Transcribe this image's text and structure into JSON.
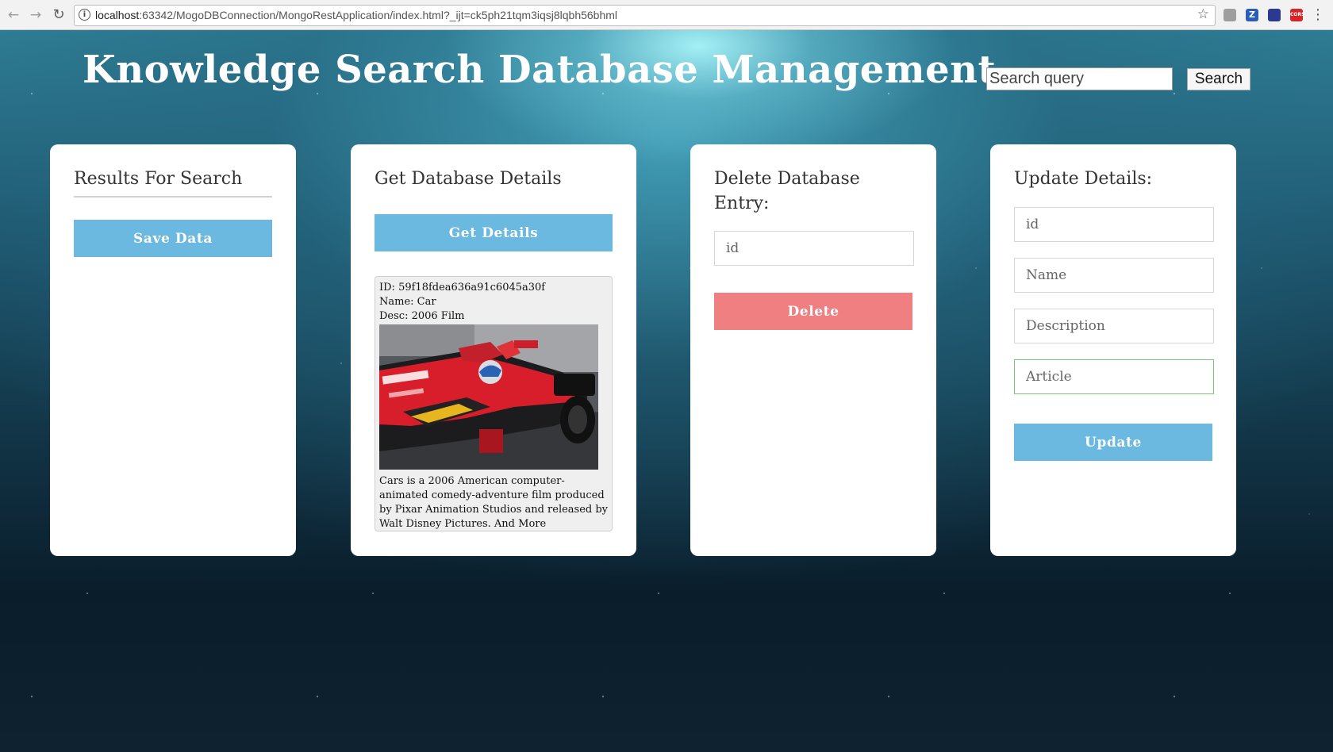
{
  "browser": {
    "url_host": "localhost",
    "url_rest": ":63342/MogoDBConnection/MongoRestApplication/index.html?_ijt=ck5ph21tqm3iqsj8lqbh56bhml",
    "extensions": [
      {
        "name": "extension-icon",
        "label": ""
      },
      {
        "name": "zotero-icon",
        "label": "Z"
      },
      {
        "name": "flag-extension-icon",
        "label": ""
      },
      {
        "name": "cors-extension-icon",
        "label": "CORS"
      }
    ]
  },
  "header": {
    "title": "Knowledge Search Database Management",
    "search_placeholder": "Search query",
    "search_button": "Search"
  },
  "results_card": {
    "title": "Results For Search",
    "save_button": "Save Data"
  },
  "get_card": {
    "title": "Get Database Details",
    "get_button": "Get Details",
    "result": {
      "id_line": "ID: 59f18fdea636a91c6045a30f",
      "name_line": "Name: Car",
      "desc_line": "Desc: 2006 Film",
      "image_alt": "red racing car",
      "article": "Cars is a 2006 American computer-animated comedy-adventure film produced by Pixar Animation Studios and released by Walt Disney Pictures. And More"
    }
  },
  "delete_card": {
    "title": "Delete Database Entry:",
    "id_placeholder": "id",
    "delete_button": "Delete"
  },
  "update_card": {
    "title": "Update Details:",
    "id_placeholder": "id",
    "name_placeholder": "Name",
    "description_placeholder": "Description",
    "article_placeholder": "Article",
    "update_button": "Update"
  },
  "colors": {
    "button_blue": "#6bb8e0",
    "button_red": "#ef7f80",
    "focus_border": "#7cc576"
  }
}
